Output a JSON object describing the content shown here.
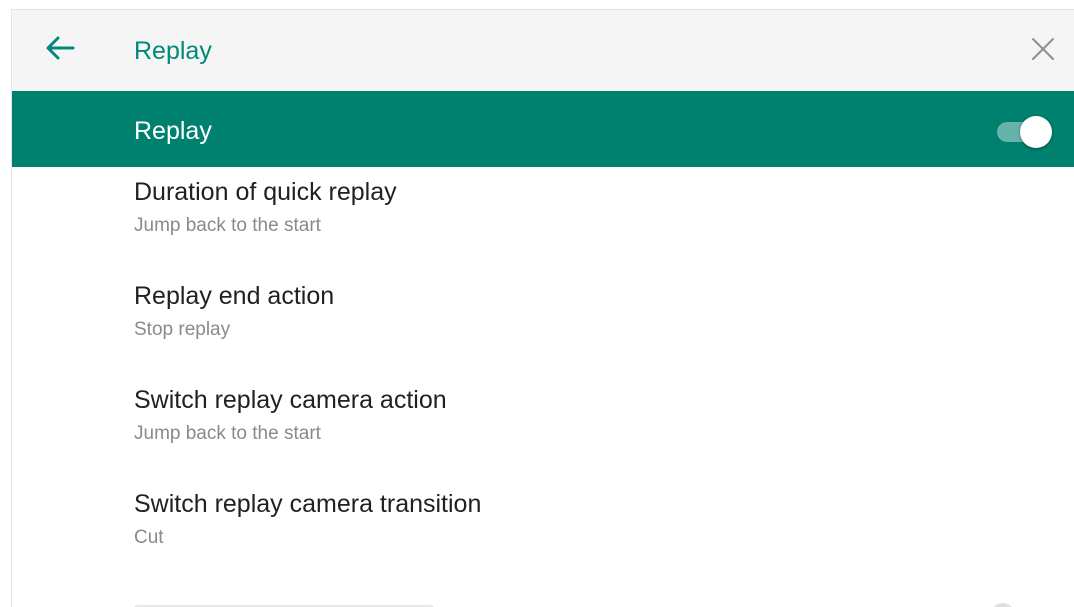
{
  "toolbar": {
    "back_icon": "arrow-left-icon",
    "title": "Replay",
    "close_icon": "close-icon"
  },
  "master_switch": {
    "label": "Replay",
    "enabled": true
  },
  "preferences": [
    {
      "title": "Duration of quick replay",
      "summary": "Jump back to the start"
    },
    {
      "title": "Replay end action",
      "summary": "Stop replay"
    },
    {
      "title": "Switch replay camera action",
      "summary": "Jump back to the start"
    },
    {
      "title": "Switch replay camera transition",
      "summary": "Cut"
    }
  ],
  "colors": {
    "accent": "#00897b",
    "master_bar": "#00806f",
    "title_text": "#212121",
    "summary_text": "#8a8a8a"
  }
}
